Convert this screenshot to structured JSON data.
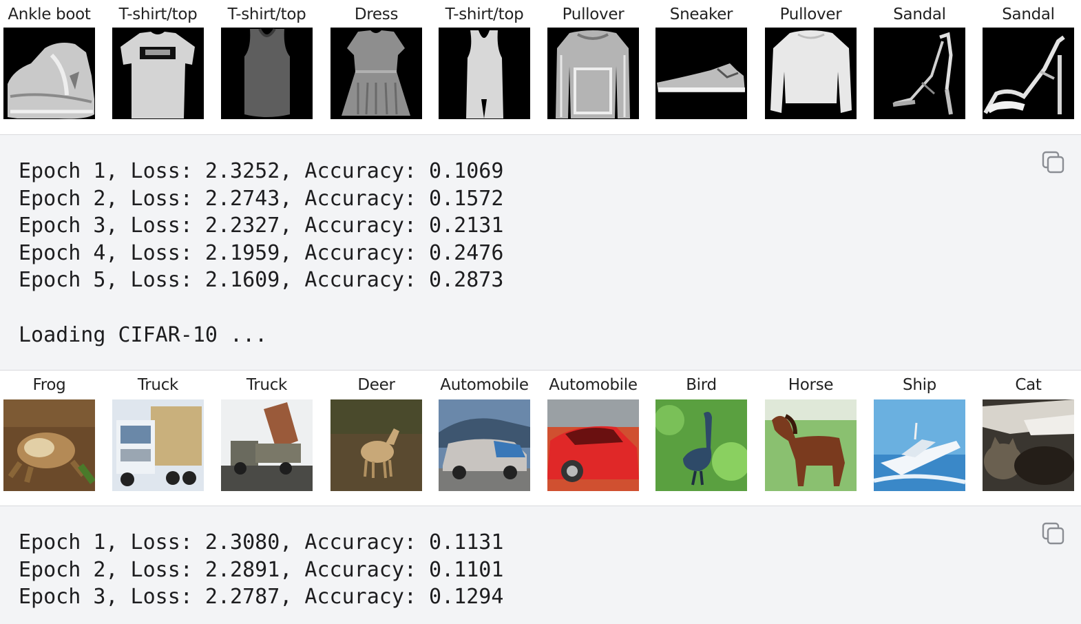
{
  "fashion_mnist": {
    "labels": [
      "Ankle boot",
      "T-shirt/top",
      "T-shirt/top",
      "Dress",
      "T-shirt/top",
      "Pullover",
      "Sneaker",
      "Pullover",
      "Sandal",
      "Sandal"
    ]
  },
  "output_1": {
    "text": "Epoch 1, Loss: 2.3252, Accuracy: 0.1069\nEpoch 2, Loss: 2.2743, Accuracy: 0.1572\nEpoch 3, Loss: 2.2327, Accuracy: 0.2131\nEpoch 4, Loss: 2.1959, Accuracy: 0.2476\nEpoch 5, Loss: 2.1609, Accuracy: 0.2873\n\nLoading CIFAR-10 ..."
  },
  "cifar10": {
    "labels": [
      "Frog",
      "Truck",
      "Truck",
      "Deer",
      "Automobile",
      "Automobile",
      "Bird",
      "Horse",
      "Ship",
      "Cat"
    ]
  },
  "output_2": {
    "text": "Epoch 1, Loss: 2.3080, Accuracy: 0.1131\nEpoch 2, Loss: 2.2891, Accuracy: 0.1101\nEpoch 3, Loss: 2.2787, Accuracy: 0.1294"
  },
  "icons": {
    "copy": "copy-icon"
  },
  "colors": {
    "output_bg": "#f3f4f6",
    "output_text": "#1d1d1f"
  }
}
